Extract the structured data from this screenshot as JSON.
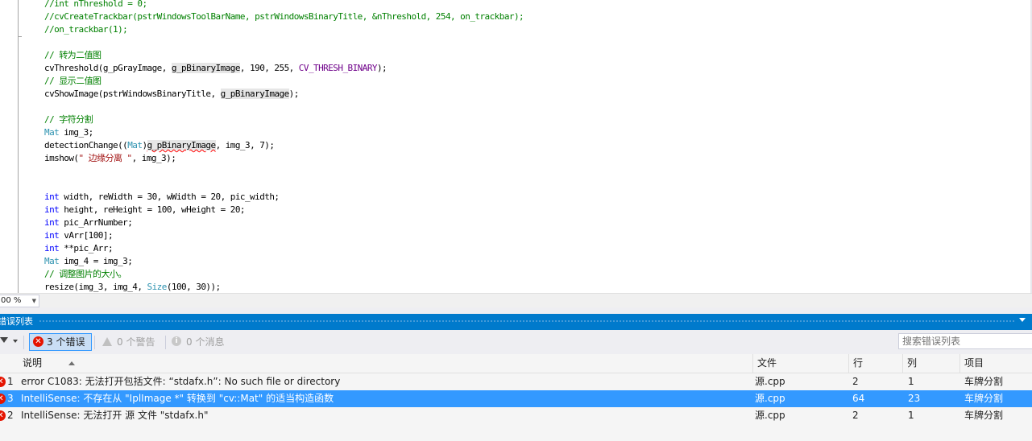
{
  "editor": {
    "lines": [
      {
        "segs": [
          {
            "t": "//int nThreshold = 0;",
            "c": "c-cmt"
          }
        ]
      },
      {
        "segs": [
          {
            "t": "//cvCreateTrackbar(pstrWindowsToolBarName, pstrWindowsBinaryTitle, &nThreshold, 254, on_trackbar);",
            "c": "c-cmt"
          }
        ]
      },
      {
        "segs": [
          {
            "t": "//on_trackbar(1);",
            "c": "c-cmt"
          }
        ]
      },
      {
        "segs": []
      },
      {
        "segs": [
          {
            "t": "// 转为二值图",
            "c": "c-cmt"
          }
        ]
      },
      {
        "segs": [
          {
            "t": "cvThreshold(g_pGrayImage, "
          },
          {
            "t": "g_pBinaryImage",
            "c": "hl"
          },
          {
            "t": ", 190, 255, "
          },
          {
            "t": "CV_THRESH_BINARY",
            "c": "c-mac"
          },
          {
            "t": ");"
          }
        ]
      },
      {
        "segs": [
          {
            "t": "// 显示二值图",
            "c": "c-cmt"
          }
        ]
      },
      {
        "segs": [
          {
            "t": "cvShowImage(pstrWindowsBinaryTitle, "
          },
          {
            "t": "g_pBinaryImage",
            "c": "hl"
          },
          {
            "t": ");"
          }
        ]
      },
      {
        "segs": []
      },
      {
        "segs": [
          {
            "t": "// 字符分割",
            "c": "c-cmt"
          }
        ]
      },
      {
        "segs": [
          {
            "t": "Mat",
            "c": "c-type"
          },
          {
            "t": " img_3;"
          }
        ]
      },
      {
        "segs": [
          {
            "t": "detectionChange(("
          },
          {
            "t": "Mat",
            "c": "c-type"
          },
          {
            "t": ")"
          },
          {
            "t": "g_pBinaryImage",
            "c": "hl squig"
          },
          {
            "t": ", img_3, 7);"
          }
        ]
      },
      {
        "segs": [
          {
            "t": "imshow("
          },
          {
            "t": "\" 边缘分离 \"",
            "c": "c-str"
          },
          {
            "t": ", img_3);"
          }
        ]
      },
      {
        "segs": []
      },
      {
        "segs": []
      },
      {
        "segs": [
          {
            "t": "int",
            "c": "c-kw"
          },
          {
            "t": " width, reWidth = 30, wWidth = 20, pic_width;"
          }
        ]
      },
      {
        "segs": [
          {
            "t": "int",
            "c": "c-kw"
          },
          {
            "t": " height, reHeight = 100, wHeight = 20;"
          }
        ]
      },
      {
        "segs": [
          {
            "t": "int",
            "c": "c-kw"
          },
          {
            "t": " pic_ArrNumber;"
          }
        ]
      },
      {
        "segs": [
          {
            "t": "int",
            "c": "c-kw"
          },
          {
            "t": " vArr[100];"
          }
        ]
      },
      {
        "segs": [
          {
            "t": "int",
            "c": "c-kw"
          },
          {
            "t": " **pic_Arr;"
          }
        ]
      },
      {
        "segs": [
          {
            "t": "Mat",
            "c": "c-type"
          },
          {
            "t": " img_4 = img_3;"
          }
        ]
      },
      {
        "segs": [
          {
            "t": "// 调整图片的大小。",
            "c": "c-cmt"
          }
        ]
      },
      {
        "segs": [
          {
            "t": "resize(img_3, img_4, "
          },
          {
            "t": "Size",
            "c": "c-type"
          },
          {
            "t": "(100, 30));"
          }
        ]
      }
    ]
  },
  "zoom": {
    "value": "00 %"
  },
  "error_list": {
    "title": "错误列表",
    "toolbar": {
      "errors_label": "3 个错误",
      "warnings_label": "0 个警告",
      "messages_label": "0 个消息",
      "search_placeholder": "搜索错误列表"
    },
    "columns": {
      "description": "说明",
      "file": "文件",
      "line": "行",
      "column": "列",
      "project": "项目"
    },
    "rows": [
      {
        "num": "1",
        "description": "error C1083: 无法打开包括文件: “stdafx.h”: No such file or directory",
        "file": "源.cpp",
        "line": "2",
        "column": "1",
        "project": "车牌分割",
        "selected": false
      },
      {
        "num": "3",
        "description": "IntelliSense: 不存在从 \"IplImage *\" 转换到 \"cv::Mat\" 的适当构造函数",
        "file": "源.cpp",
        "line": "64",
        "column": "23",
        "project": "车牌分割",
        "selected": true
      },
      {
        "num": "2",
        "description": "IntelliSense: 无法打开 源 文件 \"stdafx.h\"",
        "file": "源.cpp",
        "line": "2",
        "column": "1",
        "project": "车牌分割",
        "selected": false
      }
    ]
  },
  "colors": {
    "accent": "#007acc",
    "selection": "#3399ff",
    "error": "#e51400"
  },
  "icons": [
    "filter-icon",
    "error-icon",
    "warning-icon",
    "info-icon",
    "sort-ascending-icon",
    "chevron-down-icon"
  ]
}
